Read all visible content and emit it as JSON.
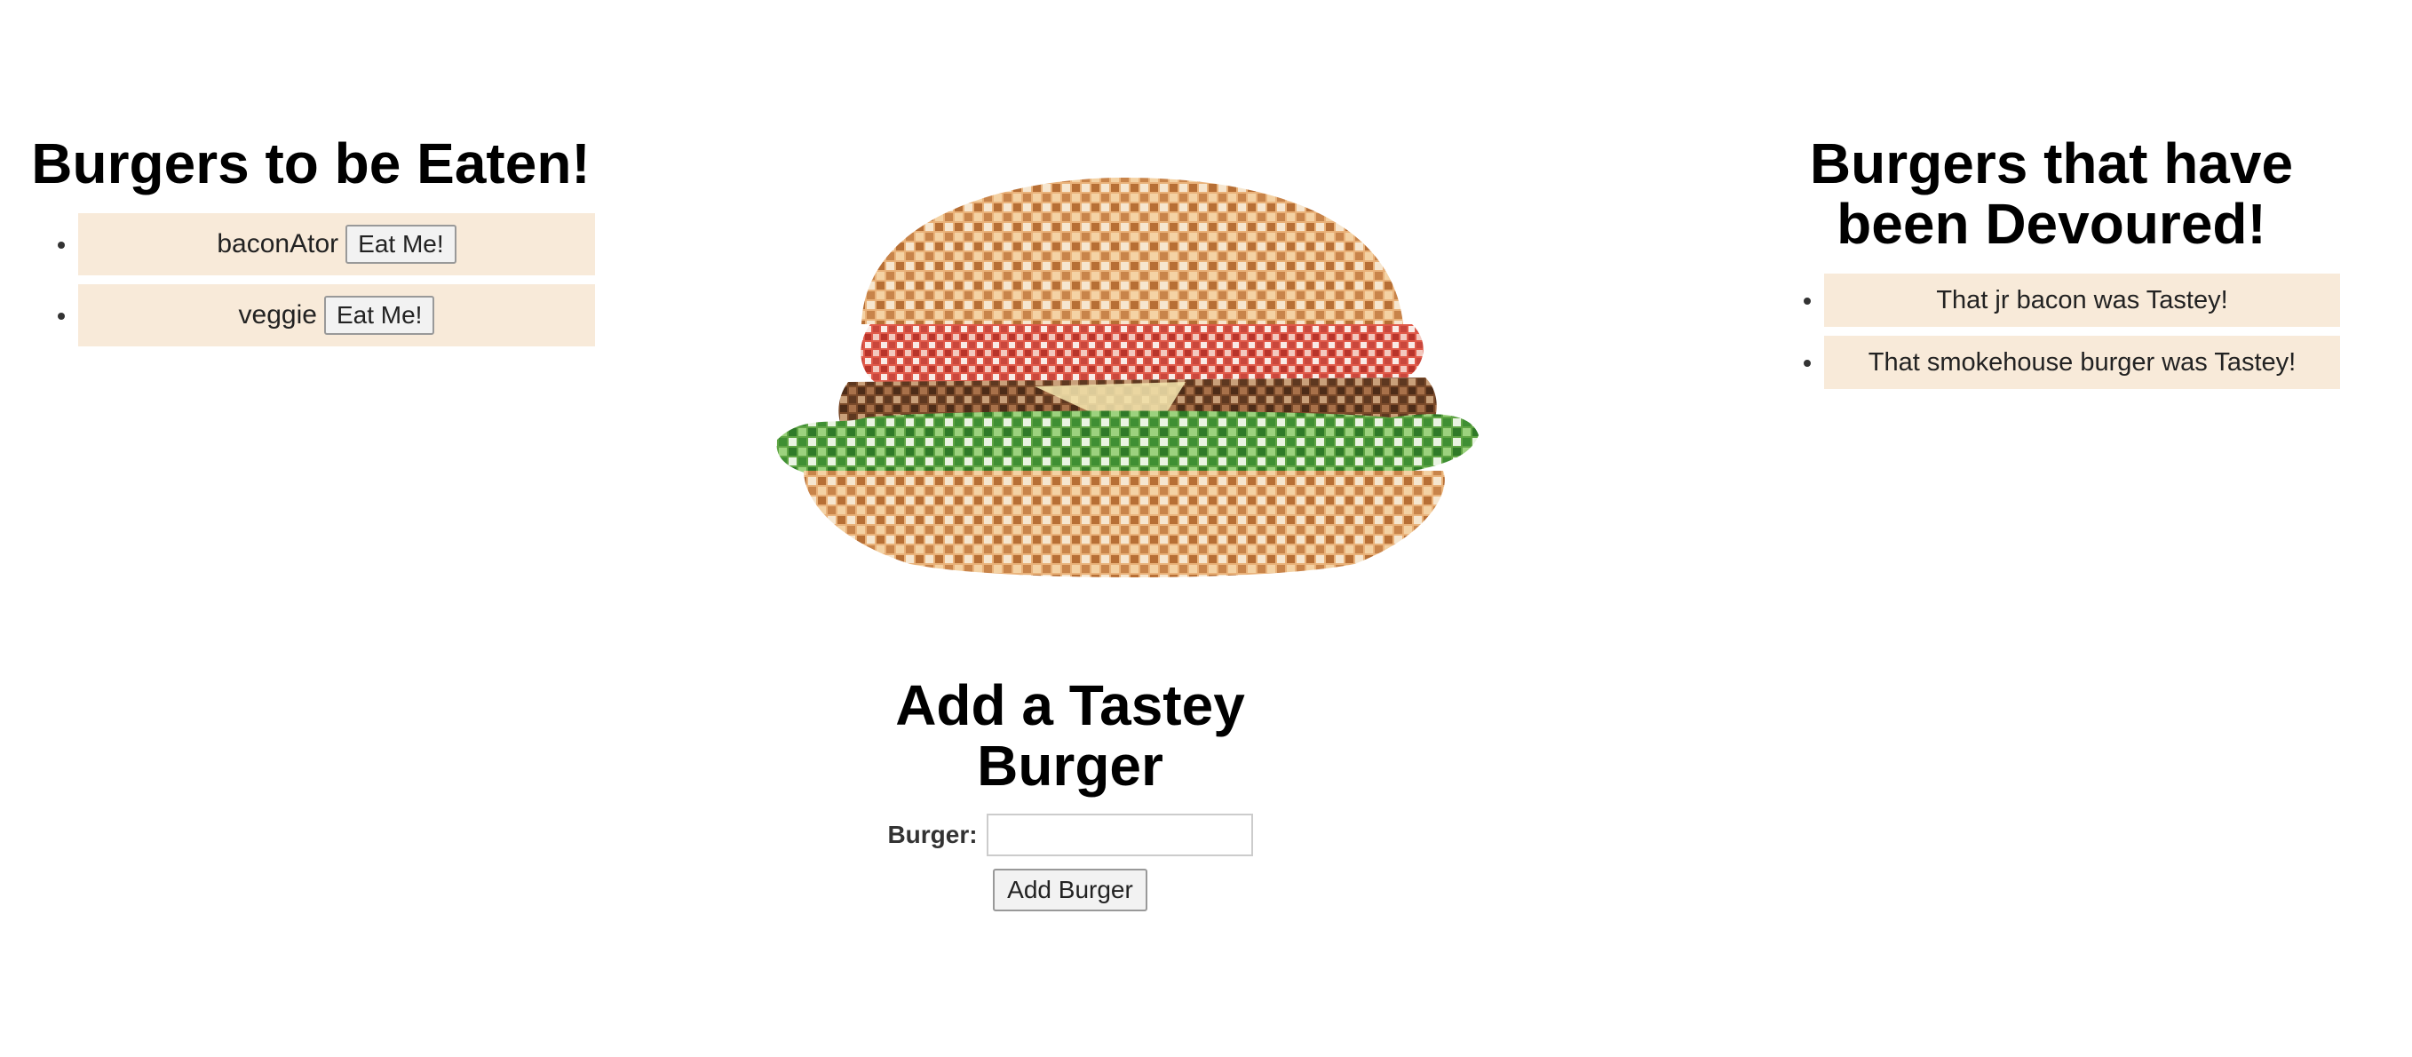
{
  "uneaten": {
    "heading": "Burgers to be Eaten!",
    "items": [
      {
        "name": "baconAtor",
        "button": "Eat Me!"
      },
      {
        "name": "veggie",
        "button": "Eat Me!"
      }
    ]
  },
  "devoured": {
    "heading": "Burgers that have been Devoured!",
    "items": [
      {
        "text": "That jr bacon was Tastey!"
      },
      {
        "text": "That smokehouse burger was Tastey!"
      }
    ]
  },
  "hero_image": {
    "icon": "burger-mosaic-image"
  },
  "add_form": {
    "heading": "Add a Tastey Burger",
    "label": "Burger:",
    "input_value": "",
    "submit_label": "Add Burger"
  },
  "colors": {
    "item_background": "#f8ead9",
    "heading": "#000000"
  }
}
